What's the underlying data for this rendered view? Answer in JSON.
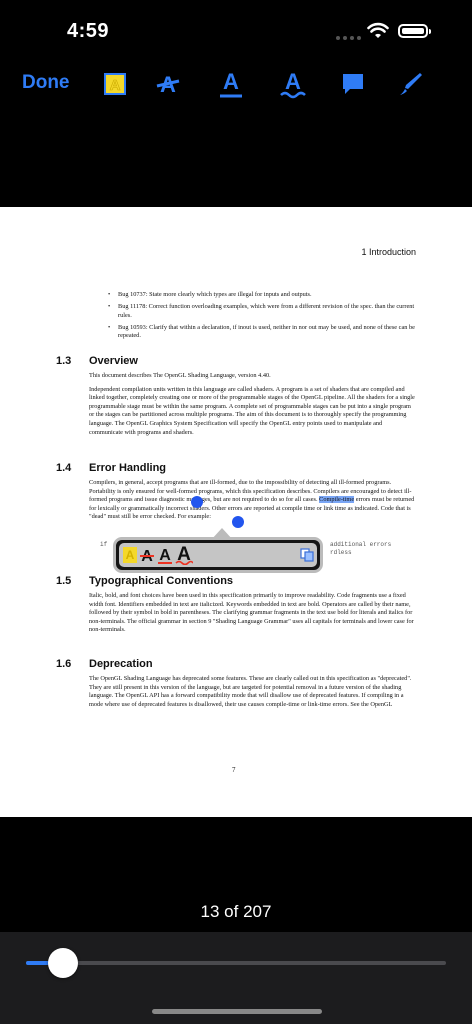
{
  "status": {
    "time": "4:59"
  },
  "toolbar": {
    "done_label": "Done",
    "tools": [
      "highlight-icon",
      "strikethrough-icon",
      "underline-icon",
      "squiggly-underline-icon",
      "note-icon",
      "pen-icon"
    ],
    "accent": "#2f7cf6"
  },
  "page": {
    "running_head": "1 Introduction",
    "bullets": [
      "Bug 10737: State more clearly which types are illegal for inputs and outputs.",
      "Bug 11178: Correct function overloading examples, which were from a different revision of the spec. than the current rules.",
      "Bug 10593: Clarify that within a declaration, if inout is used, neither in nor out may be used, and none of these can be repeated."
    ],
    "sections": [
      {
        "number": "1.3",
        "title": "Overview",
        "paragraphs": [
          "This document describes The OpenGL Shading Language, version 4.40.",
          "Independent compilation units written in this language are called shaders. A program is a set of shaders that are compiled and linked together, completely creating one or more of the programmable stages of the OpenGL pipeline. All the shaders for a single programmable stage must be within the same program. A complete set of programmable stages can be put into a single program or the stages can be partitioned across multiple programs. The aim of this document is to thoroughly specify the programming language. The OpenGL Graphics System Specification will specify the OpenGL entry points used to manipulate and communicate with programs and shaders."
        ]
      },
      {
        "number": "1.4",
        "title": "Error Handling",
        "p_before": "Compilers, in general, accept programs that are ill-formed, due to the impossibility of detecting all ill-formed programs. Portability is only ensured for well-formed programs, which this specification describes. Compilers are encouraged to detect ill-formed programs and issue diagnostic messages, but are not required to do so for all cases.",
        "p_selected": "Compile-time",
        "p_after": "errors must be returned for lexically or grammatically incorrect shaders. Other errors are reported at compile time or link time as indicated. Code that is \"dead\" must still be error checked. For example:",
        "code_left": "if",
        "code_right": "additional errors\nrdless"
      },
      {
        "number": "1.5",
        "title": "Typographical Conventions",
        "paragraphs": [
          "Italic, bold, and font choices have been used in this specification primarily to improve readability. Code fragments use a fixed width font. Identifiers embedded in text are italicized. Keywords embedded in text are bold. Operators are called by their name, followed by their symbol in bold in parentheses. The clarifying grammar fragments in the text use bold for literals and italics for non-terminals. The official grammar in section 9 \"Shading Language Grammar\" uses all capitals for terminals and lower case for non-terminals."
        ]
      },
      {
        "number": "1.6",
        "title": "Deprecation",
        "paragraphs": [
          "The OpenGL Shading Language has deprecated some features. These are clearly called out in this specification as \"deprecated\". They are still present in this version of the language, but are targeted for potential removal in a future version of the shading language. The OpenGL API has a forward compatibility mode that will disallow use of deprecated features. If compiling in a mode where use of deprecated features is disallowed, their use causes compile-time or link-time errors. See the OpenGL"
        ]
      }
    ],
    "page_number": "7"
  },
  "popup": {
    "items": [
      "highlight-icon",
      "strikethrough-icon",
      "underline-icon",
      "squiggly-underline-icon",
      "copy-icon"
    ]
  },
  "footer": {
    "page_count": "13 of 207",
    "progress": 0.088
  }
}
